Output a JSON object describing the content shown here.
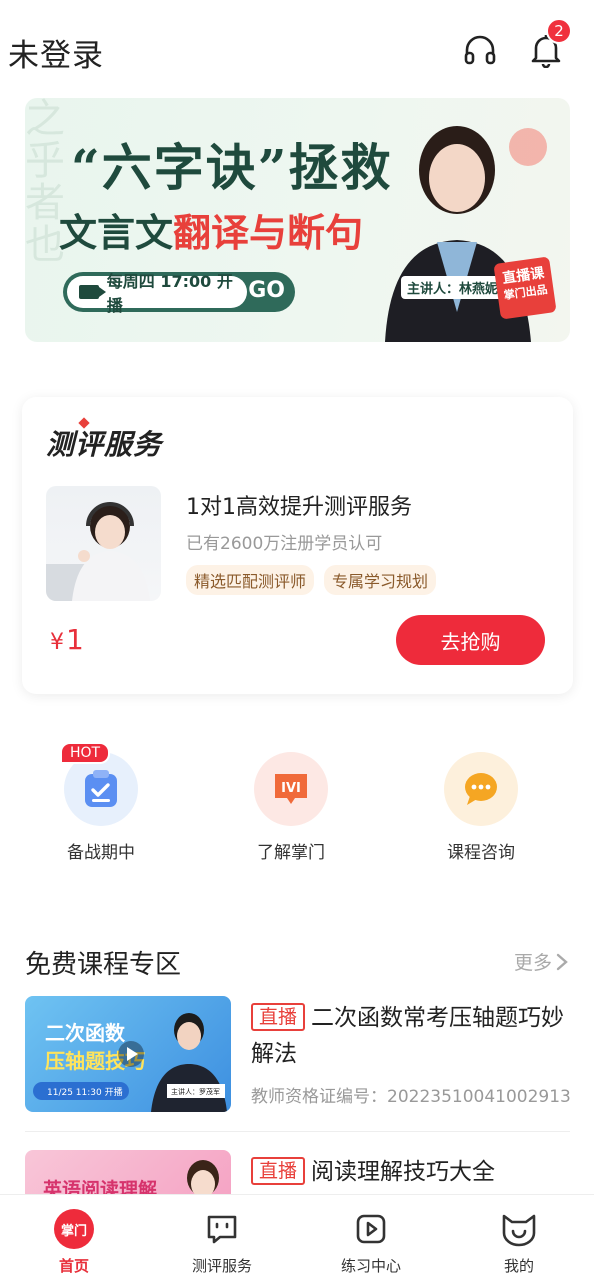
{
  "header": {
    "title": "未登录",
    "notification_count": "2",
    "icons": [
      "headset-icon",
      "bell-icon"
    ]
  },
  "banner": {
    "headline": "“六字诀”拯救",
    "subline_plain": "文言文",
    "subline_highlight": "翻译与断句",
    "schedule": "每周四 17:00 开播",
    "go": "GO",
    "presenter": "主讲人：林燕妮",
    "live_tag": "直播课",
    "live_tag_sub": "掌门出品"
  },
  "evaluation": {
    "title": "测评服务",
    "service_title": "1对1高效提升测评服务",
    "service_sub": "已有2600万注册学员认可",
    "tags": [
      "精选匹配测评师",
      "专属学习规划"
    ],
    "price_symbol": "¥",
    "price": "1",
    "buy_label": "去抢购"
  },
  "quick_entries": [
    {
      "label": "备战期中",
      "icon": "checklist-icon",
      "badge": "HOT"
    },
    {
      "label": "了解掌门",
      "icon": "ivi-logo-icon"
    },
    {
      "label": "课程咨询",
      "icon": "chat-bubble-icon"
    }
  ],
  "free_courses": {
    "title": "免费课程专区",
    "more": "更多",
    "items": [
      {
        "tag": "直播",
        "title": "二次函数常考压轴题巧妙解法",
        "cert": "教师资格证编号：20223510041002913",
        "cover_line1": "二次函数",
        "cover_line2": "压轴题技巧",
        "cover_time": "11/25 11:30 开播",
        "cover_presenter": "主讲人：罗茂军"
      },
      {
        "tag": "直播",
        "title": "阅读理解技巧大全",
        "cover_line1": "英语阅读理解"
      }
    ]
  },
  "tabbar": {
    "items": [
      {
        "label": "首页",
        "icon_text": "掌门",
        "active": true
      },
      {
        "label": "测评服务",
        "icon": "chat-face-icon"
      },
      {
        "label": "练习中心",
        "icon": "play-file-icon"
      },
      {
        "label": "我的",
        "icon": "cat-face-icon"
      }
    ]
  },
  "colors": {
    "accent": "#ee2b3b",
    "banner_green": "#1f4a3d",
    "tag_bg": "#fdf2e6"
  }
}
